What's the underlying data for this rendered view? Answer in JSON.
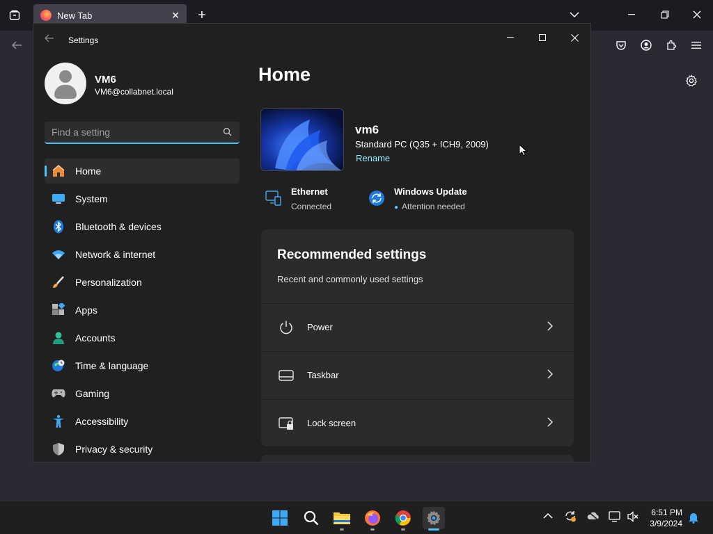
{
  "browser": {
    "tab_title": "New Tab",
    "new_tab_label": "+"
  },
  "window": {
    "title": "Settings"
  },
  "profile": {
    "name": "VM6",
    "email": "VM6@collabnet.local"
  },
  "search": {
    "placeholder": "Find a setting"
  },
  "nav": {
    "items": [
      {
        "label": "Home",
        "icon": "home-icon",
        "active": true
      },
      {
        "label": "System",
        "icon": "system-icon"
      },
      {
        "label": "Bluetooth & devices",
        "icon": "bluetooth-icon"
      },
      {
        "label": "Network & internet",
        "icon": "wifi-icon"
      },
      {
        "label": "Personalization",
        "icon": "brush-icon"
      },
      {
        "label": "Apps",
        "icon": "apps-icon"
      },
      {
        "label": "Accounts",
        "icon": "accounts-icon"
      },
      {
        "label": "Time & language",
        "icon": "globe-clock-icon"
      },
      {
        "label": "Gaming",
        "icon": "gamepad-icon"
      },
      {
        "label": "Accessibility",
        "icon": "accessibility-icon"
      },
      {
        "label": "Privacy & security",
        "icon": "shield-icon"
      }
    ]
  },
  "home": {
    "title": "Home",
    "device_name": "vm6",
    "device_model": "Standard PC (Q35 + ICH9, 2009)",
    "rename_label": "Rename",
    "ethernet_title": "Ethernet",
    "ethernet_status": "Connected",
    "update_title": "Windows Update",
    "update_status": "Attention needed"
  },
  "recommended": {
    "title": "Recommended settings",
    "subtitle": "Recent and commonly used settings",
    "items": [
      {
        "label": "Power",
        "icon": "power-icon"
      },
      {
        "label": "Taskbar",
        "icon": "taskbar-icon"
      },
      {
        "label": "Lock screen",
        "icon": "lock-screen-icon"
      }
    ]
  },
  "taskbar": {
    "time": "6:51 PM",
    "date": "3/9/2024"
  },
  "colors": {
    "accent": "#4cc2ff",
    "link": "#99ebff",
    "window_bg": "#202020",
    "card_bg": "#2b2b2b"
  }
}
